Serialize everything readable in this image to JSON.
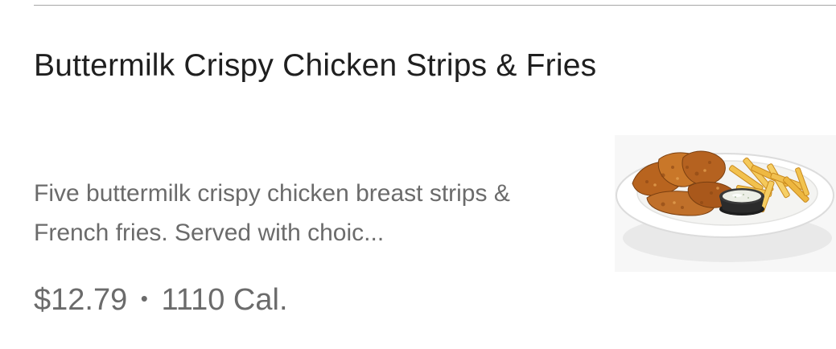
{
  "item": {
    "title": "Buttermilk Crispy Chicken Strips & Fries",
    "description": "Five buttermilk crispy chicken breast strips & French fries. Served with choic...",
    "price": "$12.79",
    "separator": "•",
    "calories": "1110 Cal.",
    "image_icon": "chicken-strips-fries-plate"
  },
  "colors": {
    "title": "#1f1f1f",
    "secondary_text": "#6b6b6b",
    "divider": "#a6a6a6",
    "background": "#ffffff"
  }
}
